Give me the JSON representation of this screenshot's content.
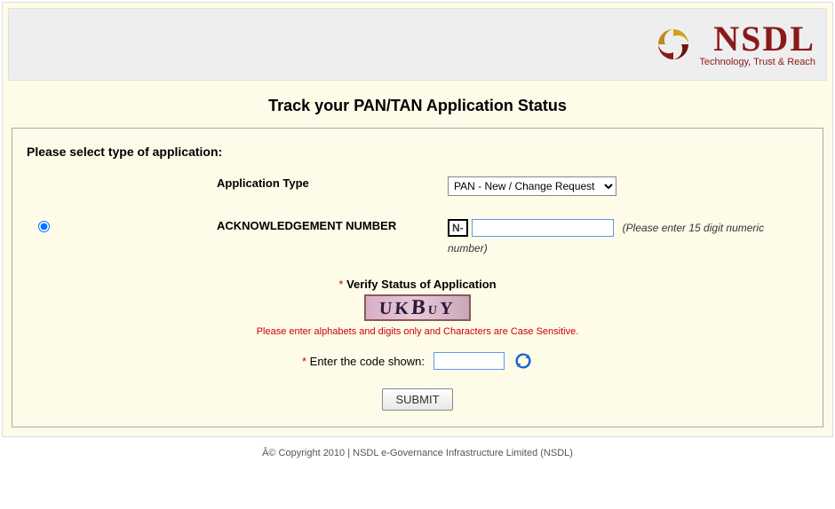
{
  "logo": {
    "name": "NSDL",
    "tagline": "Technology, Trust & Reach"
  },
  "page_title": "Track your PAN/TAN Application Status",
  "form": {
    "instruction": "Please select type of application:",
    "app_type_label": "Application Type",
    "app_type_selected": "PAN - New / Change Request",
    "ack_label": "ACKNOWLEDGEMENT NUMBER",
    "ack_prefix": "N-",
    "ack_value": "",
    "ack_hint_inline": "(Please enter 15 digit numeric",
    "ack_hint_below": "number)",
    "verify_title": "Verify Status of Application",
    "captcha_text": "UKBUY",
    "captcha_note": "Please enter alphabets and digits only and Characters are Case Sensitive.",
    "code_label": "Enter the code shown:",
    "code_value": "",
    "submit_label": "SUBMIT"
  },
  "footer": "Â© Copyright 2010  |  NSDL e-Governance Infrastructure Limited (NSDL)"
}
